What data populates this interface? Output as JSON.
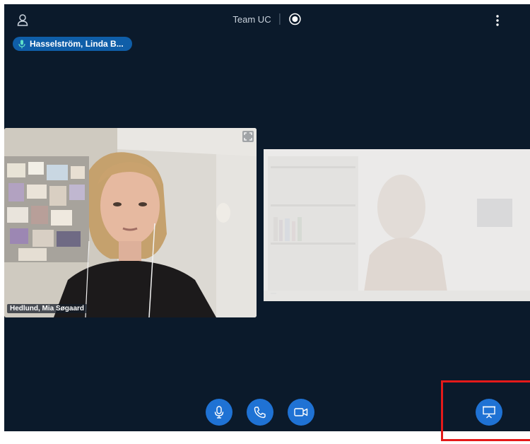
{
  "header": {
    "meeting_title": "Team UC"
  },
  "speaker": {
    "name": "Hasselström, Linda B..."
  },
  "participants": [
    {
      "name": "Hedlund, Mia Søgaard"
    },
    {
      "name": ""
    }
  ],
  "controls": {
    "mic": "microphone-icon",
    "call": "phone-icon",
    "video": "camera-icon",
    "present": "presentation-icon"
  },
  "colors": {
    "background": "#0b1a2b",
    "accent": "#1f72d4",
    "pill": "#0f5ea8",
    "highlight": "#e41a1a"
  }
}
